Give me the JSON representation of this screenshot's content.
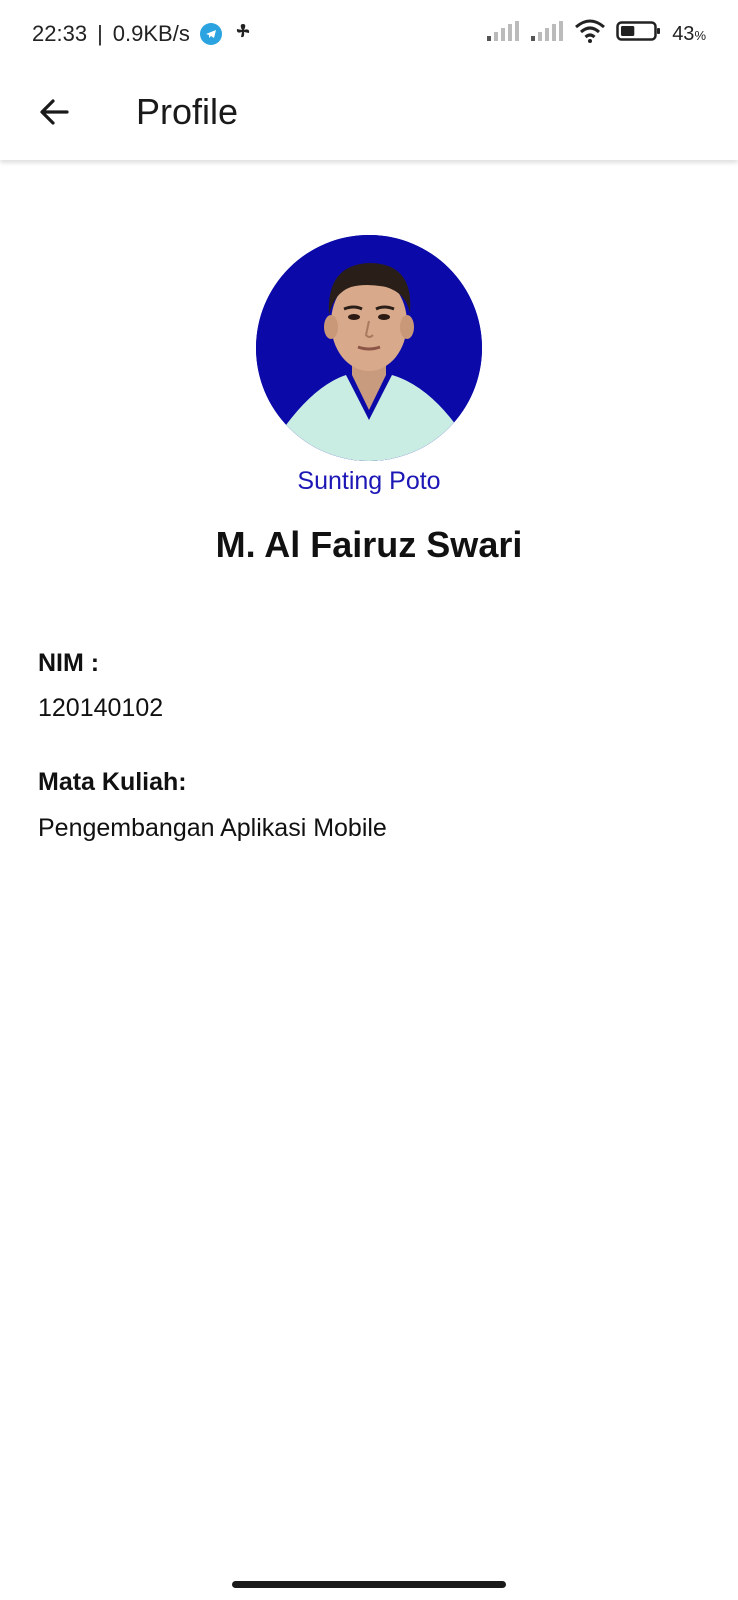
{
  "status_bar": {
    "time": "22:33",
    "network_speed": "0.9KB/s",
    "separator": "|",
    "battery_percent": "43",
    "battery_unit": "%",
    "icons": [
      "telegram-icon",
      "fan-icon",
      "signal-icon",
      "signal-icon",
      "wifi-icon",
      "battery-icon"
    ],
    "battery_level": 0.43
  },
  "app_bar": {
    "title": "Profile",
    "back_icon": "arrow-back-icon"
  },
  "profile": {
    "edit_photo_label": "Sunting Poto",
    "name": "M. Al Fairuz Swari",
    "avatar_bg": "#0b0aa8",
    "accent": "#1c17b5"
  },
  "fields": {
    "nim_label": "NIM :",
    "nim_value": "120140102",
    "course_label": "Mata Kuliah:",
    "course_value": "Pengembangan Aplikasi Mobile"
  }
}
